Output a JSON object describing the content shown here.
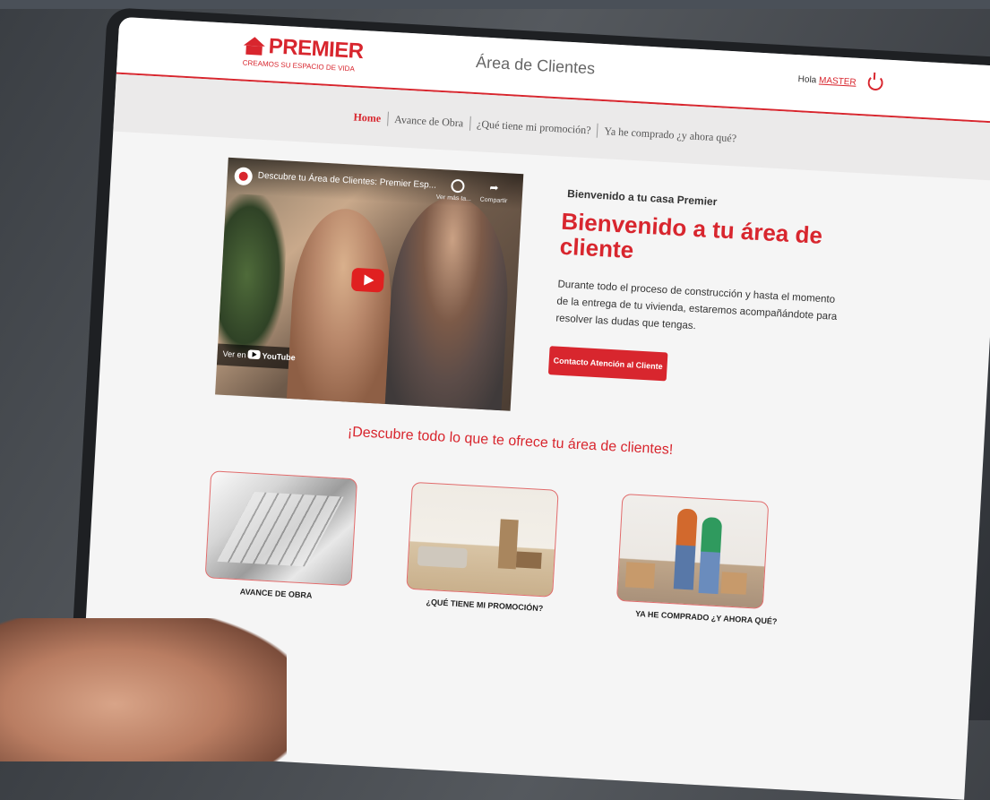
{
  "header": {
    "logo_name": "PREMIER",
    "logo_tagline": "CREAMOS SU ESPACIO DE VIDA",
    "title": "Área de Clientes",
    "greeting": "Hola",
    "username": "MASTER"
  },
  "nav": {
    "items": [
      {
        "label": "Home"
      },
      {
        "label": "Avance de Obra"
      },
      {
        "label": "¿Qué tiene mi promoción?"
      },
      {
        "label": "Ya he comprado ¿y ahora qué?"
      }
    ]
  },
  "video": {
    "title": "Descubre tu Área de Clientes: Premier Esp...",
    "watch_later": "Ver más ta...",
    "share": "Compartir",
    "watch_on": "Ver en",
    "platform": "YouTube"
  },
  "welcome": {
    "small_title": "Bienvenido a tu casa Premier",
    "heading": "Bienvenido a tu área de cliente",
    "text": "Durante todo el proceso de construcción y hasta el momento de la entrega de tu vivienda, estaremos acompañándote para resolver las dudas que tengas.",
    "button": "Contacto Atención al Cliente"
  },
  "discover": {
    "heading": "¡Descubre todo lo que te ofrece tu área de clientes!",
    "cards": [
      {
        "label": "AVANCE DE OBRA"
      },
      {
        "label": "¿QUÉ TIENE MI PROMOCIÓN?"
      },
      {
        "label": "YA HE COMPRADO ¿Y AHORA QUÉ?"
      }
    ]
  },
  "colors": {
    "brand_red": "#d8262e",
    "background": "#f5f5f5",
    "nav_background": "#ebeaea"
  },
  "icons": [
    "house-logo-icon",
    "power-icon",
    "clock-icon",
    "share-icon",
    "play-icon",
    "youtube-icon"
  ]
}
